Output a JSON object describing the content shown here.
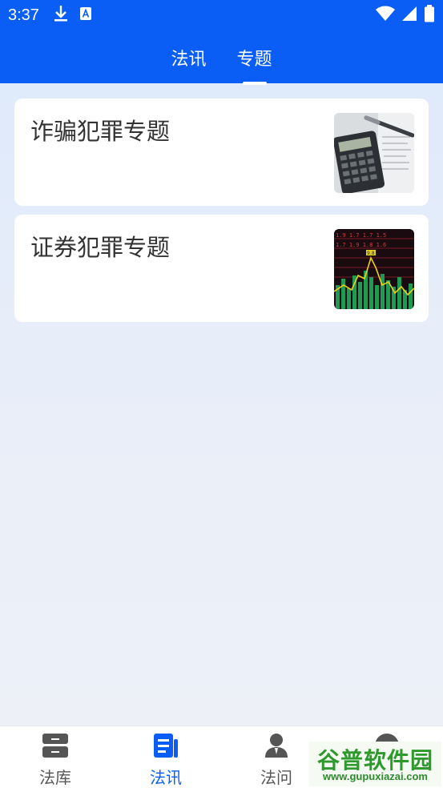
{
  "status_bar": {
    "time": "3:37",
    "left_icons": [
      "download-icon",
      "autofill-icon"
    ],
    "right_icons": [
      "wifi-icon",
      "signal-icon",
      "battery-icon"
    ]
  },
  "header": {
    "tabs": [
      {
        "label": "法讯",
        "active": false
      },
      {
        "label": "专题",
        "active": true
      }
    ],
    "color": "#0a5ef5"
  },
  "topics": [
    {
      "title": "诈骗犯罪专题",
      "thumbnail": "calculator-documents-image"
    },
    {
      "title": "证券犯罪专题",
      "thumbnail": "stock-chart-image",
      "thumb_badge": "9.8"
    }
  ],
  "bottom_nav": {
    "items": [
      {
        "label": "法库",
        "icon": "database-icon",
        "active": false
      },
      {
        "label": "法讯",
        "icon": "news-icon",
        "active": true
      },
      {
        "label": "法问",
        "icon": "person-icon",
        "active": false
      },
      {
        "label": "",
        "icon": "chat-icon",
        "active": false
      }
    ],
    "active_color": "#0a5ef5"
  },
  "watermark": {
    "title": "谷普软件园",
    "url": "www.gupuxiazai.com"
  }
}
